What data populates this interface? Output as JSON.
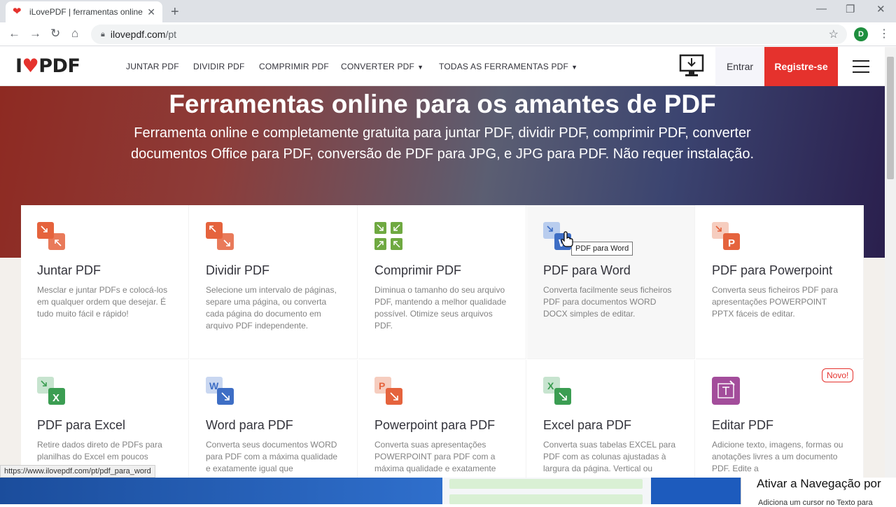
{
  "browser": {
    "tab_title": "iLovePDF | ferramentas online pa",
    "url_host": "ilovepdf.com",
    "url_path": "/pt",
    "profile_initial": "D"
  },
  "header": {
    "logo_left": "I",
    "logo_right": "PDF",
    "menu": [
      {
        "label": "JUNTAR PDF"
      },
      {
        "label": "DIVIDIR PDF"
      },
      {
        "label": "COMPRIMIR PDF"
      },
      {
        "label": "CONVERTER PDF"
      },
      {
        "label": "TODAS AS FERRAMENTAS PDF"
      }
    ],
    "login_label": "Entrar",
    "register_label": "Registre-se"
  },
  "hero": {
    "title": "Ferramentas online para os amantes de PDF",
    "subtitle": "Ferramenta online e completamente gratuita para juntar PDF, dividir PDF, comprimir PDF, converter documentos Office para PDF, conversão de PDF para JPG, e JPG para PDF. Não requer instalação."
  },
  "tools": [
    {
      "title": "Juntar PDF",
      "desc": "Mesclar e juntar PDFs e colocá-los em qualquer ordem que desejar. É tudo muito fácil e rápido!",
      "icon": "merge-icon",
      "color": "#e5633d"
    },
    {
      "title": "Dividir PDF",
      "desc": "Selecione um intervalo de páginas, separe uma página, ou converta cada página do documento em arquivo PDF independente.",
      "icon": "split-icon",
      "color": "#e5633d"
    },
    {
      "title": "Comprimir PDF",
      "desc": "Diminua o tamanho do seu arquivo PDF, mantendo a melhor qualidade possível. Otimize seus arquivos PDF.",
      "icon": "compress-icon",
      "color": "#6fa941"
    },
    {
      "title": "PDF para Word",
      "desc": "Converta facilmente seus ficheiros PDF para documentos WORD DOCX simples de editar.",
      "icon": "word-icon",
      "color": "#3e6ec5"
    },
    {
      "title": "PDF para Powerpoint",
      "desc": "Converta seus ficheiros PDF para apresentações POWERPOINT PPTX fáceis de editar.",
      "icon": "powerpoint-icon",
      "color": "#e5633d"
    },
    {
      "title": "PDF para Excel",
      "desc": "Retire dados direto de PDFs para planilhas do Excel em poucos",
      "icon": "excel-icon",
      "color": "#3b9d52"
    },
    {
      "title": "Word para PDF",
      "desc": "Converta seus documentos WORD para PDF com a máxima qualidade e exatamente igual que",
      "icon": "word-icon",
      "color": "#3e6ec5"
    },
    {
      "title": "Powerpoint para PDF",
      "desc": "Converta suas apresentações POWERPOINT para PDF com a máxima qualidade e exatamente",
      "icon": "powerpoint-icon",
      "color": "#e5633d"
    },
    {
      "title": "Excel para PDF",
      "desc": "Converta suas tabelas EXCEL para PDF com as colunas ajustadas à largura da página. Vertical ou",
      "icon": "excel-icon",
      "color": "#3b9d52"
    },
    {
      "title": "Editar PDF",
      "desc": "Adicione texto, imagens, formas ou anotações livres a um documento PDF. Edite a",
      "icon": "edit-icon",
      "color": "#a34d9b"
    }
  ],
  "badge_new": "Novo!",
  "tooltip": "PDF para Word",
  "status_url": "https://www.ilovepdf.com/pt/pdf_para_word",
  "overlay": {
    "popup_title": "Ativar a Navegação por",
    "popup_sub": "Adiciona um cursor no Texto para"
  }
}
